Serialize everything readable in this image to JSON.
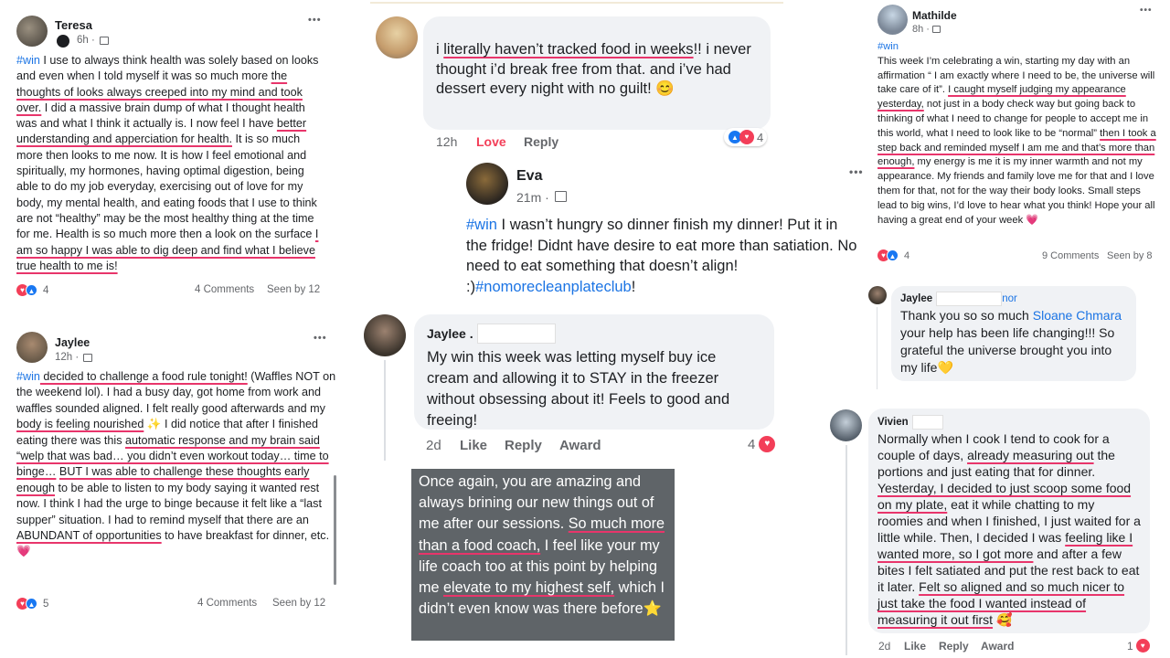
{
  "teresa": {
    "name": "Teresa",
    "time": "6h ·",
    "more": "•••",
    "hashtag": "#win",
    "text": [
      " I use to always think health was solely based on looks and even when I told myself it was so much more ",
      "the thoughts of looks always creeped into my mind and took over.",
      " I did a massive brain dump of what I thought health was and what I think it actually is. I now feel I have ",
      "better understanding and apperciation for health.",
      " It is so much more then looks to me now. It is how I feel emotional and spiritually, my hormones,  having optimal digestion, being able to do my job everyday, exercising out of love for my body, my mental health, and eating foods that I use to think are not “healthy” may be the most healthy thing at the time for me.  Health is so much more then a look on the surface ",
      "I am so happy I was able to dig deep and find what I believe true health to me is!"
    ],
    "reaction_count": "4",
    "comments": "4 Comments",
    "seen": "Seen by 12"
  },
  "jaylee_left": {
    "name": "Jaylee",
    "time": "12h ·",
    "more": "•••",
    "hashtag": "#win",
    "text": [
      " decided to challenge a food rule tonight!",
      " (Waffles NOT on the weekend lol). I had a busy day, got home from work and waffles sounded aligned. I felt really good afterwards and my ",
      "body is feeling nourished",
      " ✨ I did notice that after I finished eating there was this ",
      "automatic response and my brain said “welp that was bad… you didn’t even workout today… time to binge…",
      " ",
      "BUT I was able to challenge these thoughts early enough",
      " to be able to listen to my body saying it wanted rest now. I think I had the urge to binge because it felt like a “last supper” situation. I had to remind myself that there are an ",
      "ABUNDANT of opportunities",
      " to have breakfast for dinner, etc. 💗"
    ],
    "reaction_count": "5",
    "comments": "4 Comments",
    "seen": "Seen by 12"
  },
  "center_top": {
    "text_a": "i ",
    "text_ul": "literally haven’t tracked food in weeks",
    "text_b": "!! i never thought i’d break free from that. and i’ve had dessert every night with no guilt! 😊",
    "time": "12h",
    "love": "Love",
    "reply": "Reply",
    "reaction_count": "4"
  },
  "eva": {
    "name": "Eva",
    "time": "21m ·",
    "more": "•••",
    "hashtag": "#win",
    "text": " I wasn’t hungry so dinner finish my dinner! Put it in the fridge! Didnt have desire to eat more than satiation. No need to eat something that doesn’t align! :)",
    "hashtag2": "#nomorecleanplateclub",
    "tail": "!"
  },
  "jaylee_center": {
    "name": "Jaylee .",
    "text": "My win this week was letting myself buy ice cream and allowing it to STAY in the freezer without obsessing about it! Feels to good and freeing!",
    "time": "2d",
    "like": "Like",
    "reply": "Reply",
    "award": "Award",
    "reaction_count": "4"
  },
  "dark_note": {
    "a": "Once again, you are amazing and always brining our new things out of me after our sessions. ",
    "b": "So much more than a food coach,",
    "c": " I feel like your my life coach too at this point by helping me ",
    "d": "elevate to my highest self,",
    "e": " which I didn’t even know was there before⭐"
  },
  "mathilde": {
    "name": "Mathilde",
    "time": "8h ·",
    "more": "•••",
    "hashtag": "#win",
    "text": [
      "This week I’m celebrating a win, starting my day with an affirmation “ I am exactly where I need to be, the universe will take care of it”. ",
      "I caught myself judging my appearance yesterday,",
      " not just in a body check way but going back to thinking of what I need to change for people to accept me in this world, what I need to look like to be “normal” ",
      "then I took a step back and reminded myself I am me and that’s more than enough,",
      " my energy is me it is my inner warmth and not my appearance. My friends and family love me for that and I love them for that, not for the way their body looks. Small steps lead to big wins, I’d love to hear what you think! Hope your all having a great end of your week 💗"
    ],
    "reaction_count": "4",
    "comments": "9 Comments",
    "seen": "Seen by 8"
  },
  "jaylee_right": {
    "name": "Jaylee",
    "name_tail": "nor",
    "text_a": "Thank you so so much ",
    "mention": "Sloane Chmara",
    "text_b": " your help has been life changing!!! So grateful the universe brought you into my life💛"
  },
  "vivien": {
    "name": "Vivien",
    "text": [
      "Normally when I cook I tend to cook for a couple of days, ",
      "already measuring out",
      " the portions and just eating that for dinner. ",
      "Yesterday, I decided to just scoop some food on my plate,",
      " eat it while chatting to my roomies and when I finished, I just waited for a little while. Then, I decided I was ",
      "feeling like I wanted more, so I got more",
      " and after a few bites I felt satiated and put the rest back to eat it later. ",
      "Felt so aligned and so much nicer to just take the food I wanted instead of measuring it out first",
      " 🥰"
    ],
    "time": "2d",
    "like": "Like",
    "reply": "Reply",
    "award": "Award",
    "reaction_count": "1"
  },
  "colors": {
    "underline": "#e8356b",
    "hashtag": "#1b74e4",
    "bubble": "#f0f2f5",
    "dark_note": "#5f6468",
    "heart": "#f33e58",
    "like": "#1877f2"
  }
}
